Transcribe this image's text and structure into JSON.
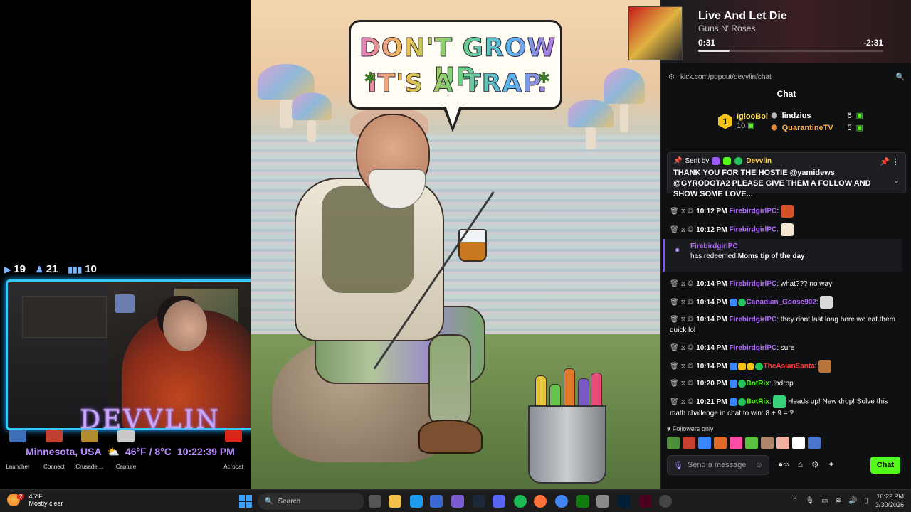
{
  "overlay": {
    "stats": [
      {
        "icon": "kick-icon",
        "value": "19"
      },
      {
        "icon": "user-icon",
        "value": "21"
      },
      {
        "icon": "bars-icon",
        "value": "10"
      }
    ],
    "brand": "DEVVLIN",
    "location": "Minnesota, USA",
    "temperature": "46°F / 8°C",
    "time": "10:22:39 PM",
    "desktop_icons": [
      {
        "label": "Launcher",
        "icon": "launcher-icon"
      },
      {
        "label": "Connect",
        "icon": "connect-icon"
      },
      {
        "label": "Crusade ...",
        "icon": "crusade-icon"
      },
      {
        "label": "Capture",
        "icon": "capture-icon"
      },
      {
        "label": "Acrobat",
        "icon": "acrobat-icon"
      }
    ]
  },
  "artwork": {
    "line1": "DON'T GROW UP,",
    "line2": "IT'S A TRAP."
  },
  "now_playing": {
    "title": "Live And Let Die",
    "artist": "Guns N' Roses",
    "elapsed": "0:31",
    "remaining": "-2:31",
    "progress": 0.17
  },
  "browser": {
    "url": "kick.com/popout/devvlin/chat"
  },
  "chat": {
    "title": "Chat",
    "leaderboard": {
      "first": {
        "rank": "1",
        "name": "IglooBoi",
        "points": "10"
      },
      "others": [
        {
          "name": "lindzius",
          "points": "6"
        },
        {
          "name": "QuarantineTV",
          "points": "5"
        }
      ]
    },
    "pinned": {
      "sent_by_label": "Sent by",
      "sender": "Devvlin",
      "text": "THANK YOU FOR THE HOSTIE @yamidews @GYRODOTA2 PLEASE GIVE THEM A FOLLOW AND SHOW SOME LOVE..."
    },
    "messages": [
      {
        "time": "10:12 PM",
        "user": "FirebirdgirlPC",
        "text": "",
        "user_color": "#b56bff"
      },
      {
        "time": "10:12 PM",
        "user": "FirebirdgirlPC",
        "text": "",
        "user_color": "#b56bff"
      },
      {
        "time": "10:14 PM",
        "user": "FirebirdgirlPC",
        "text": "what??? no way",
        "user_color": "#b56bff"
      },
      {
        "time": "10:14 PM",
        "user": "Canadian_Goose902",
        "text": "",
        "user_color": "#b56bff"
      },
      {
        "time": "10:14 PM",
        "user": "FirebirdgirlPC",
        "text": "they dont last long here we eat them quick lol",
        "user_color": "#b56bff"
      },
      {
        "time": "10:14 PM",
        "user": "FirebirdgirlPC",
        "text": "sure",
        "user_color": "#b56bff"
      },
      {
        "time": "10:14 PM",
        "user": "TheAsianSanta",
        "text": "",
        "user_color": "#ff3b3b"
      },
      {
        "time": "10:20 PM",
        "user": "BotRix",
        "text": "!bdrop",
        "user_color": "#53fc18"
      },
      {
        "time": "10:21 PM",
        "user": "BotRix",
        "text": "Heads up! New drop! Solve this math challenge in chat to win: 8 + 9 = ?",
        "user_color": "#53fc18"
      }
    ],
    "redeem": {
      "user": "FirebirdgirlPC",
      "prefix": "has redeemed",
      "reward": "Moms tip of the day"
    },
    "followers_only": "Followers only",
    "input_placeholder": "Send a message",
    "send_label": "Chat"
  },
  "taskbar": {
    "weather_temp": "45°F",
    "weather_desc": "Mostly clear",
    "weather_badge": "2",
    "search_placeholder": "Search",
    "clock_time": "10:22 PM",
    "clock_date": "3/30/2026"
  },
  "colors": {
    "kick_green": "#53fc18",
    "username_purple": "#b56bff",
    "accent_cyan": "#35c9ff"
  }
}
